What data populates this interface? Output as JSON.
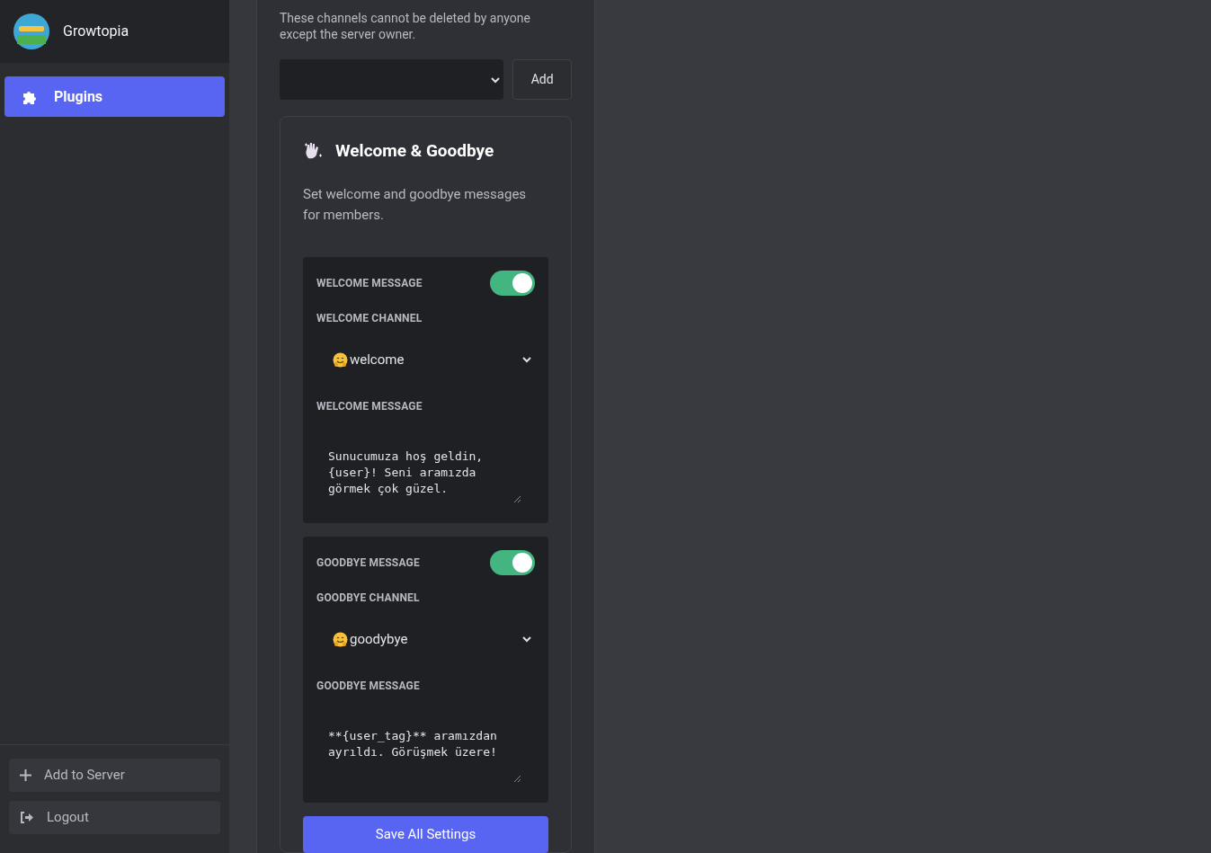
{
  "server": {
    "name": "Growtopia"
  },
  "nav": [
    {
      "label": "Plugins",
      "selected": true
    }
  ],
  "sidebar_footer": [
    {
      "kind": "add",
      "label": "Add to Server"
    },
    {
      "kind": "logout",
      "label": "Logout"
    }
  ],
  "protected_channels": {
    "description": "These channels cannot be deleted by anyone except the server owner.",
    "add_button": "Add"
  },
  "plugin": {
    "title": "Welcome & Goodbye",
    "description": "Set welcome and goodbye messages for members.",
    "sections": [
      {
        "toggle_label": "WELCOME MESSAGE",
        "on": true,
        "channel_label": "WELCOME CHANNEL",
        "channel": "welcome",
        "message_label": "WELCOME MESSAGE",
        "message": "Sunucumuza hoş geldin, {user}! Seni aramızda görmek çok güzel."
      },
      {
        "toggle_label": "GOODBYE MESSAGE",
        "on": true,
        "channel_label": "GOODBYE CHANNEL",
        "channel": "goodybye",
        "message_label": "GOODBYE MESSAGE",
        "message": "**{user_tag}** aramızdan ayrıldı. Görüşmek üzere!"
      }
    ],
    "save_button": "Save All Settings"
  }
}
